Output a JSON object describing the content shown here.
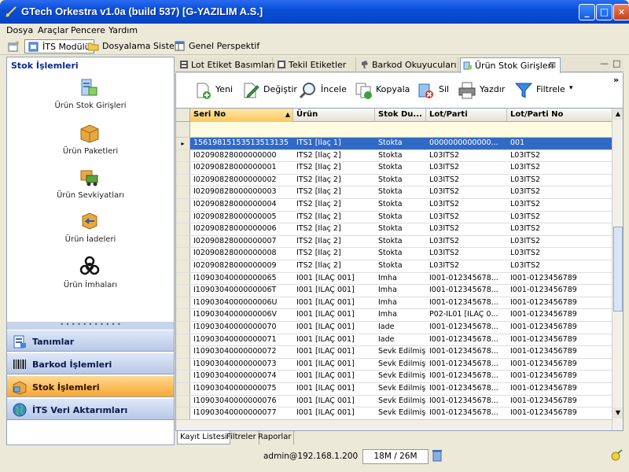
{
  "window": {
    "title": "GTech Orkestra v1.0a (build 537) [G-YAZILIM A.S.]",
    "min": "_",
    "max": "□",
    "close": "✕"
  },
  "menu": [
    "Dosya",
    "Araçlar",
    "Pencere",
    "Yardım"
  ],
  "perspectives": [
    "İTS Modülü",
    "Dosyalama Sistemi",
    "Genel Perspektif"
  ],
  "left": {
    "header": "Stok İşlemleri",
    "nav": [
      "Ürün Stok Girişleri",
      "Ürün Paketleri",
      "Ürün Sevkiyatları",
      "Ürün İadeleri",
      "Ürün İmhaları"
    ],
    "grip": "• • • • • • • • • • •",
    "accordion": [
      "Tanımlar",
      "Barkod İşlemleri",
      "Stok İşlemleri",
      "İTS Veri Aktarımları"
    ],
    "selected": "Stok İşlemleri"
  },
  "tabs": [
    "Lot Etiket Basımları",
    "Tekil Etiketler",
    "Barkod Okuyucuları",
    "Ürün Stok Girişleri"
  ],
  "tab_close": "⊠",
  "tab_ctl": [
    "—",
    "□"
  ],
  "toolbar": {
    "buttons": [
      "Yeni",
      "Değiştir",
      "İncele",
      "Kopyala",
      "Sil",
      "Yazdır",
      "Filtrele"
    ],
    "dropdown": "▾",
    "overflow": "»"
  },
  "grid": {
    "columns": [
      "Seri No",
      "Ürün",
      "Stok Du...",
      "Lot/Parti",
      "Lot/Parti No"
    ],
    "sort_arrow": "▲",
    "row_marker": "▸",
    "rows": [
      [
        "15619815153513513135",
        "ITS1 [İlaç 1]",
        "Stokta",
        "0000000000000...",
        "001"
      ],
      [
        "I02090828000000000",
        "ITS2 [İlaç 2]",
        "Stokta",
        "L03ITS2",
        "L03ITS2"
      ],
      [
        "I02090828000000001",
        "ITS2 [İlaç 2]",
        "Stokta",
        "L03ITS2",
        "L03ITS2"
      ],
      [
        "I02090828000000002",
        "ITS2 [İlaç 2]",
        "Stokta",
        "L03ITS2",
        "L03ITS2"
      ],
      [
        "I02090828000000003",
        "ITS2 [İlaç 2]",
        "Stokta",
        "L03ITS2",
        "L03ITS2"
      ],
      [
        "I02090828000000004",
        "ITS2 [İlaç 2]",
        "Stokta",
        "L03ITS2",
        "L03ITS2"
      ],
      [
        "I02090828000000005",
        "ITS2 [İlaç 2]",
        "Stokta",
        "L03ITS2",
        "L03ITS2"
      ],
      [
        "I02090828000000006",
        "ITS2 [İlaç 2]",
        "Stokta",
        "L03ITS2",
        "L03ITS2"
      ],
      [
        "I02090828000000007",
        "ITS2 [İlaç 2]",
        "Stokta",
        "L03ITS2",
        "L03ITS2"
      ],
      [
        "I02090828000000008",
        "ITS2 [İlaç 2]",
        "Stokta",
        "L03ITS2",
        "L03ITS2"
      ],
      [
        "I02090828000000009",
        "ITS2 [İlaç 2]",
        "Stokta",
        "L03ITS2",
        "L03ITS2"
      ],
      [
        "I10903040000000065",
        "I001 [İLAÇ 001]",
        "İmha",
        "I001-012345678...",
        "I001-0123456789"
      ],
      [
        "I1090304000000006T",
        "I001 [İLAÇ 001]",
        "İmha",
        "I001-012345678...",
        "I001-0123456789"
      ],
      [
        "I1090304000000006U",
        "I001 [İLAÇ 001]",
        "İmha",
        "I001-012345678...",
        "I001-0123456789"
      ],
      [
        "I1090304000000006V",
        "I001 [İLAÇ 001]",
        "İmha",
        "P02-IL01 [İLAÇ 0...",
        "I001-0123456789"
      ],
      [
        "I10903040000000070",
        "I001 [İLAÇ 001]",
        "İade",
        "I001-012345678...",
        "I001-0123456789"
      ],
      [
        "I10903040000000071",
        "I001 [İLAÇ 001]",
        "İade",
        "I001-012345678...",
        "I001-0123456789"
      ],
      [
        "I10903040000000072",
        "I001 [İLAÇ 001]",
        "Sevk Edilmiş",
        "I001-012345678...",
        "I001-0123456789"
      ],
      [
        "I10903040000000073",
        "I001 [İLAÇ 001]",
        "Sevk Edilmiş",
        "I001-012345678...",
        "I001-0123456789"
      ],
      [
        "I10903040000000074",
        "I001 [İLAÇ 001]",
        "Sevk Edilmiş",
        "I001-012345678...",
        "I001-0123456789"
      ],
      [
        "I10903040000000075",
        "I001 [İLAÇ 001]",
        "Sevk Edilmiş",
        "I001-012345678...",
        "I001-0123456789"
      ],
      [
        "I10903040000000076",
        "I001 [İLAÇ 001]",
        "Sevk Edilmiş",
        "I001-012345678...",
        "I001-0123456789"
      ],
      [
        "I10903040000000077",
        "I001 [İLAÇ 001]",
        "Sevk Edilmiş",
        "I001-012345678...",
        "I001-0123456789"
      ]
    ],
    "selected_row": 0,
    "scroll": {
      "up": "▲",
      "down": "▼"
    }
  },
  "bottom_tabs": [
    "Kayıt Listesi",
    "Filtreler",
    "Raporlar"
  ],
  "status": {
    "user": "admin@192.168.1.200",
    "memory": "18M / 26M"
  },
  "colors": {
    "title_bar": "#0a4fd8",
    "selection": "#316ac5",
    "accordion_selected": "#f8a830",
    "header_text": "#0a2a8c"
  }
}
